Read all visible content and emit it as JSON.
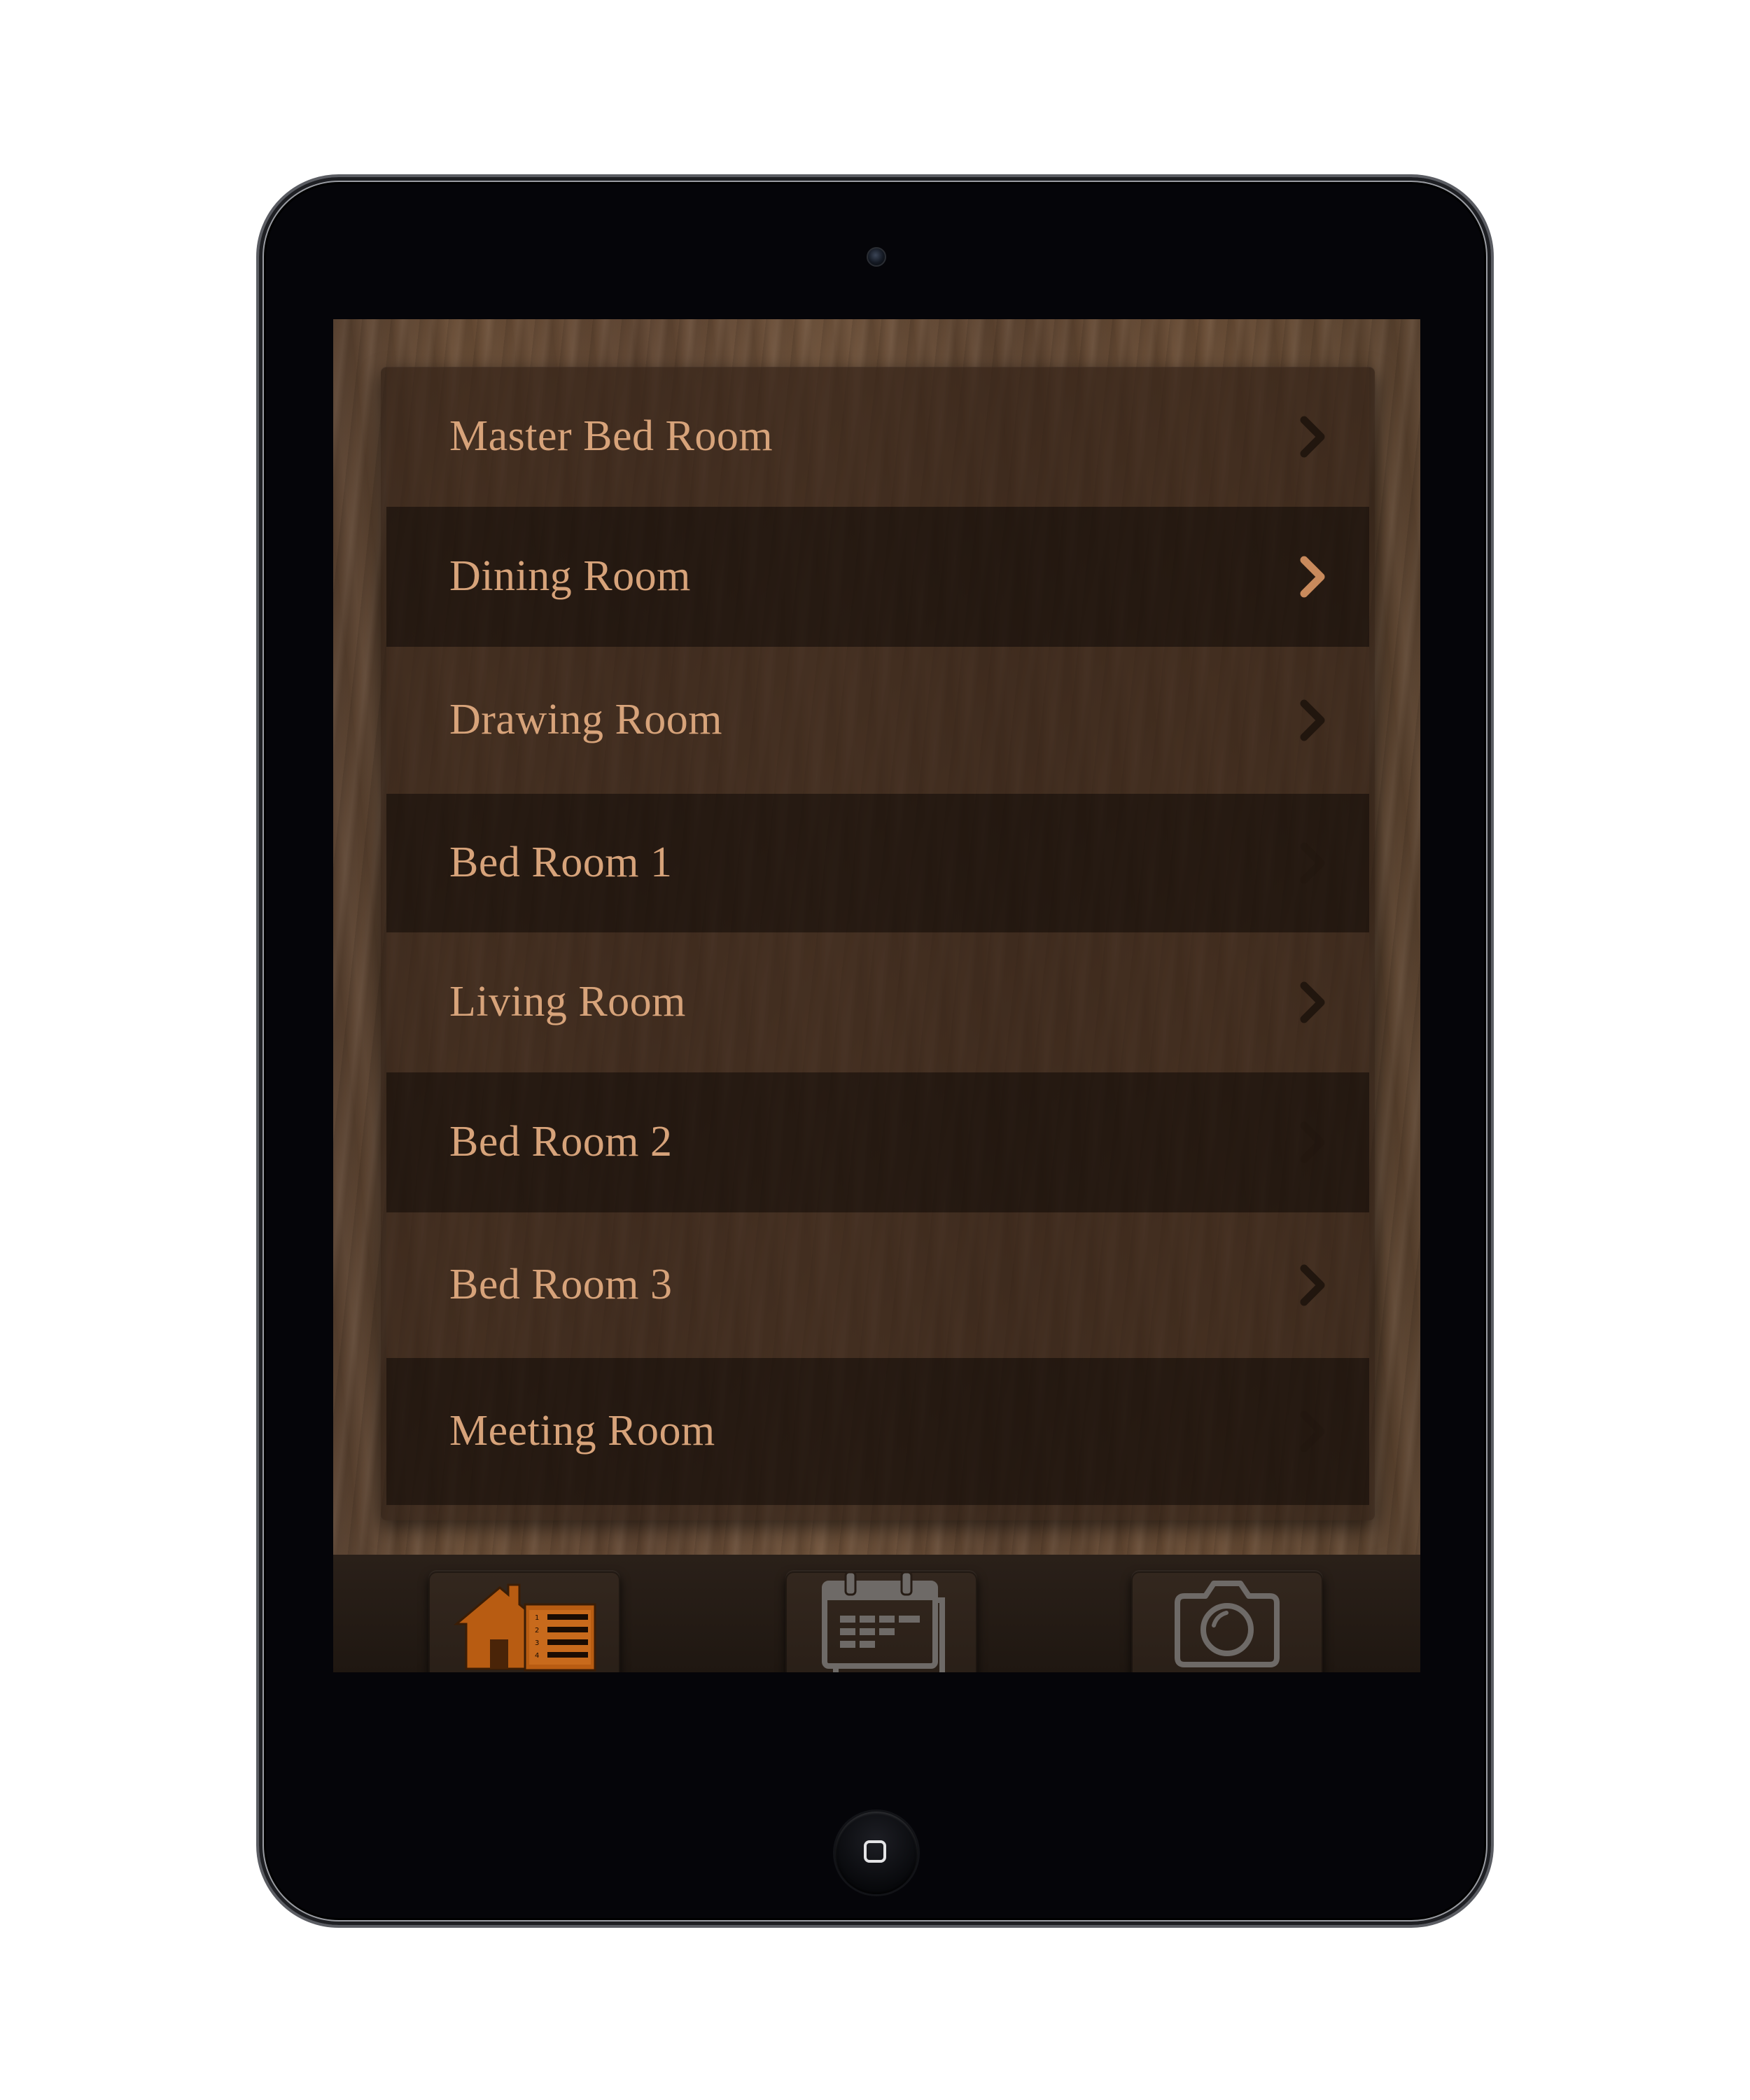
{
  "rooms": [
    {
      "label": "Master Bed Room",
      "style": "light",
      "chevron_visible": true
    },
    {
      "label": "Dining Room",
      "style": "dark",
      "chevron_visible": true,
      "selected": true
    },
    {
      "label": "Drawing Room",
      "style": "light",
      "chevron_visible": true
    },
    {
      "label": "Bed Room 1",
      "style": "dark",
      "chevron_visible": false
    },
    {
      "label": "Living Room",
      "style": "light",
      "chevron_visible": true
    },
    {
      "label": "Bed Room 2",
      "style": "dark",
      "chevron_visible": false
    },
    {
      "label": "Bed Room 3",
      "style": "light",
      "chevron_visible": true
    },
    {
      "label": "Meeting Room",
      "style": "dark",
      "chevron_visible": false
    }
  ],
  "tabs": [
    {
      "name": "rooms",
      "icon": "house-list-icon",
      "active": true
    },
    {
      "name": "calendar",
      "icon": "calendar-icon",
      "active": false
    },
    {
      "name": "camera",
      "icon": "camera-icon",
      "active": false
    }
  ],
  "colors": {
    "label_text": "#d7a37a",
    "active_icon": "#b85c12",
    "inactive_icon": "#6e6a67",
    "chevron_selected": "#c98a5c",
    "chevron_default": "#1e140d"
  }
}
